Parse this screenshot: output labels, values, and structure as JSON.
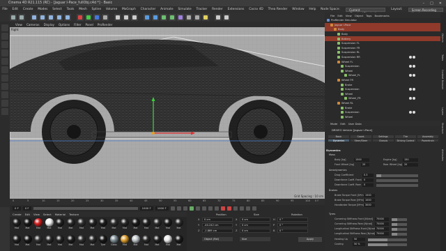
{
  "window": {
    "title": "Cinema 4D R21.115 (RC) - [Jaguar I-Pace_fullObj.c4d *] - Basic"
  },
  "menubar": {
    "items": [
      "File",
      "Edit",
      "Create",
      "Modes",
      "Select",
      "Tools",
      "Mesh",
      "Spline",
      "Volume",
      "MoGraph",
      "Character",
      "Animate",
      "Simulate",
      "Tracker",
      "Render",
      "Extensions",
      "Cacsv 4D",
      "Thea Render",
      "Window",
      "Help"
    ],
    "node_space_label": "Node Space:",
    "node_space_value": "Current (Standard/Physical)",
    "layout_label": "Layout:",
    "layout_value": "Screen Recording (Jens)"
  },
  "viewport": {
    "menu": [
      "View",
      "Cameras",
      "Display",
      "Options",
      "Filter",
      "Panel",
      "ProRender"
    ],
    "label": "Right",
    "grid_spacing": "Grid Spacing : 10 cm"
  },
  "timeline": {
    "ticks": [
      "0",
      "5",
      "10",
      "15",
      "20",
      "25",
      "30",
      "35",
      "40",
      "45",
      "50",
      "55",
      "60",
      "65",
      "70",
      "75",
      "80",
      "85",
      "90",
      "95",
      "100"
    ],
    "current_frame": "0 F",
    "start_frame": "0 F",
    "end_frame": "1000 F",
    "max_frame": "1000 F",
    "frame_indicator": "0 F"
  },
  "materials": {
    "menu": [
      "Create",
      "Edit",
      "View",
      "Select",
      "Material",
      "Texture"
    ],
    "row1": [
      {
        "label": "Mat",
        "color": "#222222"
      },
      {
        "label": "Mat",
        "color": "#1a1a1a"
      },
      {
        "label": "Mat",
        "color": "#d82020"
      },
      {
        "label": "Mat",
        "color": "#f2f2f2"
      },
      {
        "label": "Mat",
        "color": "#222222"
      },
      {
        "label": "Mat",
        "color": "#2a2a2a"
      },
      {
        "label": "Mat",
        "color": "#333333"
      },
      {
        "label": "Mat",
        "color": "#262626"
      },
      {
        "label": "Mat",
        "color": "#1e1e1e"
      },
      {
        "label": "Mat",
        "color": "#303030"
      },
      {
        "label": "Mat",
        "color": "#2a2a2a"
      },
      {
        "label": "Mat",
        "color": "#1c1c1c"
      },
      {
        "label": "Mat",
        "color": "#242424"
      },
      {
        "label": "Mat",
        "color": "#2e2e2e"
      },
      {
        "label": "Mat",
        "color": "#1f1f1f"
      },
      {
        "label": "Mat",
        "color": "#2c2c2c"
      }
    ],
    "row2": [
      {
        "label": "Mat",
        "color": "#222222"
      },
      {
        "label": "Mat",
        "color": "#1a1a1a"
      },
      {
        "label": "Mat",
        "color": "#333333"
      },
      {
        "label": "Mat",
        "color": "#2a2a2a"
      },
      {
        "label": "Mat",
        "color": "#262626"
      },
      {
        "label": "Mat",
        "color": "#1e1e1e"
      },
      {
        "label": "Mat",
        "color": "#303030"
      },
      {
        "label": "Mat",
        "color": "#2c2c2c"
      },
      {
        "label": "Tyre",
        "color": "#1a1a1a"
      },
      {
        "label": "Glass",
        "color": "#7f8f96"
      },
      {
        "label": "Mat",
        "color": "#e0a030"
      },
      {
        "label": "Mat",
        "color": "#bfc5c9"
      },
      {
        "label": "Mat",
        "color": "#2a2a2a"
      },
      {
        "label": "Mat",
        "color": "#222222"
      },
      {
        "label": "Mat",
        "color": "#e8e8e8"
      },
      {
        "label": "Mat",
        "color": "#1c1c1c"
      }
    ]
  },
  "coordinates": {
    "headers": [
      "Position",
      "Size",
      "Rotation"
    ],
    "rows": [
      {
        "axis": "X",
        "pos": "0 cm",
        "size": "0 cm",
        "rot_axis": "H",
        "rot": "0 °"
      },
      {
        "axis": "Y",
        "pos": "-40.242 cm",
        "size": "0 cm",
        "rot_axis": "P",
        "rot": "0 °"
      },
      {
        "axis": "Z",
        "pos": "-1.869 cm",
        "size": "0 cm",
        "rot_axis": "B",
        "rot": "0 °"
      }
    ],
    "mode": "Object (Rel)",
    "size_mode": "Size",
    "apply": "Apply"
  },
  "object_manager": {
    "tabs": [
      "File",
      "Edit",
      "View",
      "Object",
      "Tags",
      "Bookmarks"
    ],
    "items": [
      {
        "name": "ProRender Simulator",
        "indent": 0,
        "color": "#6a8fd0",
        "selected": false,
        "tags": 0
      },
      {
        "name": "Jaguar I-Pace",
        "indent": 1,
        "color": "#d08a3a",
        "selected": true,
        "tags": 0
      },
      {
        "name": "Body",
        "indent": 2,
        "color": "#d08a3a",
        "selected": true,
        "tags": 0
      },
      {
        "name": "Body",
        "indent": 3,
        "color": "#8ac06a",
        "selected": false,
        "tags": 0
      },
      {
        "name": "Battery",
        "indent": 3,
        "color": "#8ac06a",
        "selected": true,
        "tags": 0
      },
      {
        "name": "Suspension FL",
        "indent": 3,
        "color": "#8ac06a",
        "selected": false,
        "tags": 0
      },
      {
        "name": "Suspension FR",
        "indent": 3,
        "color": "#8ac06a",
        "selected": false,
        "tags": 0
      },
      {
        "name": "Suspension RL",
        "indent": 3,
        "color": "#8ac06a",
        "selected": false,
        "tags": 0
      },
      {
        "name": "Suspension RR",
        "indent": 3,
        "color": "#8ac06a",
        "selected": false,
        "tags": 2
      },
      {
        "name": "Wheel FL",
        "indent": 3,
        "color": "#d08a3a",
        "selected": false,
        "tags": 0
      },
      {
        "name": "Suspension",
        "indent": 4,
        "color": "#8ac06a",
        "selected": false,
        "tags": 2
      },
      {
        "name": "Wheel",
        "indent": 4,
        "color": "#8ac06a",
        "selected": false,
        "tags": 0
      },
      {
        "name": "Wheel_FL",
        "indent": 5,
        "color": "#8ac06a",
        "selected": false,
        "tags": 2
      },
      {
        "name": "Wheel FR",
        "indent": 3,
        "color": "#d08a3a",
        "selected": false,
        "tags": 0
      },
      {
        "name": "Brake",
        "indent": 4,
        "color": "#8ac06a",
        "selected": false,
        "tags": 0
      },
      {
        "name": "Suspension",
        "indent": 4,
        "color": "#8ac06a",
        "selected": false,
        "tags": 2
      },
      {
        "name": "Wheel",
        "indent": 4,
        "color": "#8ac06a",
        "selected": false,
        "tags": 0
      },
      {
        "name": "Wheel_FR",
        "indent": 5,
        "color": "#8ac06a",
        "selected": false,
        "tags": 2
      },
      {
        "name": "Wheel RL",
        "indent": 3,
        "color": "#d08a3a",
        "selected": false,
        "tags": 0
      },
      {
        "name": "Brake",
        "indent": 4,
        "color": "#8ac06a",
        "selected": false,
        "tags": 0
      },
      {
        "name": "Suspension",
        "indent": 4,
        "color": "#8ac06a",
        "selected": false,
        "tags": 2
      },
      {
        "name": "Wheel",
        "indent": 4,
        "color": "#8ac06a",
        "selected": false,
        "tags": 0
      }
    ]
  },
  "attribute_manager": {
    "tabs": [
      "Mode",
      "Edit",
      "User Data"
    ],
    "title": "DRIVEO Vehicle [Jaguar I-Pace]",
    "subtabs": [
      "Basic",
      "Coord.",
      "Settings",
      "Tire",
      "Assembly",
      "Dynamics",
      "Steer/Steer",
      "Chassis",
      "Driving Control",
      "Powertrain"
    ],
    "active_subtab": "Dynamics",
    "section": "Dynamics",
    "groups": {
      "mass": "Mass",
      "aero": "Aerodynamics",
      "brakes": "Brakes",
      "tyres": "Tyres"
    },
    "fields": {
      "body_kg_label": "Body [kg]",
      "body_kg": "1500",
      "engine_kg_label": "Engine [kg]",
      "engine_kg": "150",
      "front_wheel_label": "Front Wheel [kg]",
      "front_wheel": "20",
      "rear_wheel_label": "Rear Wheel [kg]",
      "rear_wheel": "20",
      "drag_label": "Drag Coefficient",
      "drag": "0.3",
      "df_front_label": "Downforce Coeff. Front",
      "df_front": "0",
      "df_rear_label": "Downforce Coeff. Rear",
      "df_rear": "0",
      "bt_front_label": "Brake Torque Front [N*m]",
      "bt_front": "1500",
      "bt_rear_label": "Brake Torque Rear [N*m]",
      "bt_rear": "1000",
      "hb_label": "Handbrake Torque [N*m]",
      "hb": "3000",
      "cs_front_label": "Cornering Stiffness Front [N/rad]",
      "cs_front": "75000",
      "cs_rear_label": "Cornering Stiffness Rear [N/rad]",
      "cs_rear": "75000",
      "ls_front_label": "Longitudinal Stiffness Front [N/rad]",
      "ls_front": "75000",
      "ls_rear_label": "Longitudinal Stiffness Rear [N/rad]",
      "ls_rear": "75000",
      "heating_label": "Heating Up",
      "heating": "50",
      "cooling_label": "Cooling",
      "cooling": "50 %"
    }
  },
  "side_tabs": [
    "Objects",
    "Takes",
    "Content Browser",
    "Layers",
    "Structure",
    "Attributes"
  ]
}
